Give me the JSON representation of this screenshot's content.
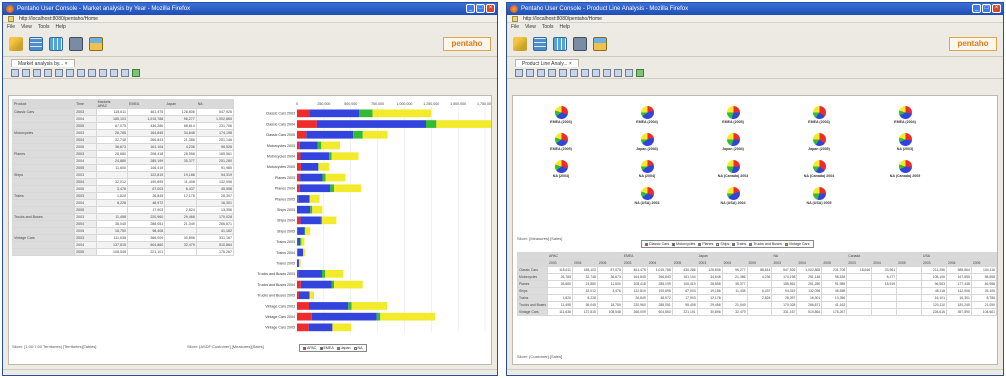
{
  "windows": {
    "left": {
      "title": "Pentaho User Console - Market analysis by Year - Mozilla Firefox",
      "url": "http://localhost:8080/pentaho/Home",
      "menu": [
        "File",
        "View",
        "Tools",
        "Help"
      ],
      "tab_label": "Market analysis by... ×",
      "footer_left": "Slicer: [1:00:7:00 Territories] [Territories][Tables]",
      "footer_right": "Slicer: [ASDF:Customer] [Measures][Sales]"
    },
    "right": {
      "title": "Pentaho User Console - Product Line Analysis - Mozilla Firefox",
      "url": "http://localhost:8080/pentaho/Home",
      "menu": [
        "File",
        "View",
        "Tools",
        "Help"
      ],
      "tab_label": "Product Line Analy... ×",
      "slicer_top": "Slicer: [Measures].[Sales]",
      "slicer_bottom": "Slicer: [Customer].[Sales]"
    }
  },
  "brand": {
    "logo_text": "pentaho",
    "accent": "#e07a20",
    "titlebar": "#1f4fb5"
  },
  "icons": [
    "edit-report-icon",
    "analysis-view-icon",
    "report-icon",
    "save-icon",
    "open-folder-icon"
  ],
  "pivot_left": {
    "headers": [
      "Product",
      "Time",
      "Markets",
      "APAC",
      "EMEA",
      "Japan",
      "NA"
    ],
    "rows": [
      [
        "Classic Cars",
        "2003",
        "115,611",
        "461,475",
        "126,806",
        "547,926"
      ],
      [
        "",
        "2004",
        "185,103",
        "1,015,788",
        "96,277",
        "1,002,865"
      ],
      [
        "",
        "2005",
        "87,075",
        "436,286",
        "88,814",
        "231,706"
      ],
      [
        "Motorcycles",
        "2003",
        "26,785",
        "164,845",
        "34,648",
        "174,198"
      ],
      [
        "",
        "2004",
        "32,748",
        "266,843",
        "21,386",
        "251,146"
      ],
      [
        "",
        "2005",
        "36,673",
        "161,104",
        "4,236",
        "98,528"
      ],
      [
        "Planes",
        "2003",
        "28,680",
        "208,418",
        "28,558",
        "185,561"
      ],
      [
        "",
        "2004",
        "24,880",
        "285,199",
        "35,377",
        "251,280"
      ],
      [
        "",
        "2005",
        "11,600",
        "106,419",
        "",
        "91,985"
      ],
      [
        "Ships",
        "2003",
        "",
        "122,819",
        "19,186",
        "94,319"
      ],
      [
        "",
        "2004",
        "32,012",
        "190,895",
        "11,408",
        "132,098"
      ],
      [
        "",
        "2005",
        "3,476",
        "67,003",
        "6,437",
        "45,558"
      ],
      [
        "Trains",
        "2003",
        "1,820",
        "26,849",
        "12,178",
        "28,397"
      ],
      [
        "",
        "2004",
        "8,228",
        "48,972",
        "",
        "16,301"
      ],
      [
        "",
        "2005",
        "",
        "17,903",
        "2,824",
        "13,356"
      ],
      [
        "Trucks and Buses",
        "2003",
        "11,498",
        "220,960",
        "29,468",
        "170,028"
      ],
      [
        "",
        "2004",
        "36,045",
        "288,051",
        "21,049",
        "266,671"
      ],
      [
        "",
        "2005",
        "18,750",
        "98,408",
        "",
        "41,162"
      ],
      [
        "Vintage Cars",
        "2003",
        "111,638",
        "366,009",
        "30,896",
        "331,167"
      ],
      [
        "",
        "2004",
        "137,815",
        "604,860",
        "32,479",
        "510,864"
      ],
      [
        "",
        "2005",
        "108,548",
        "221,101",
        "",
        "176,267"
      ]
    ]
  },
  "chart_data": [
    {
      "type": "bar",
      "orientation": "horizontal",
      "stacked": true,
      "categories": [
        "Classic Cars 2003",
        "Classic Cars 2004",
        "Classic Cars 2005",
        "Motorcycles 2003",
        "Motorcycles 2004",
        "Motorcycles 2005",
        "Planes 2003",
        "Planes 2004",
        "Planes 2005",
        "Ships 2003",
        "Ships 2004",
        "Ships 2005",
        "Trains 2003",
        "Trains 2004",
        "Trains 2005",
        "Trucks and Buses 2003",
        "Trucks and Buses 2004",
        "Trucks and Buses 2005",
        "Vintage Cars 2003",
        "Vintage Cars 2004",
        "Vintage Cars 2005"
      ],
      "series": [
        {
          "name": "APAC",
          "color": "#ee2c2c",
          "values": [
            115611,
            185103,
            87075,
            26785,
            32748,
            36673,
            28680,
            24880,
            11600,
            0,
            32012,
            3476,
            1820,
            8228,
            0,
            11498,
            36045,
            18750,
            111638,
            137815,
            108548
          ]
        },
        {
          "name": "EMEA",
          "color": "#3344dd",
          "values": [
            461475,
            1015788,
            436286,
            164845,
            266843,
            161104,
            208418,
            285199,
            106419,
            122819,
            190895,
            67003,
            26849,
            48972,
            17903,
            220960,
            288051,
            98408,
            366009,
            604860,
            221101
          ]
        },
        {
          "name": "Japan",
          "color": "#33bb33",
          "values": [
            126806,
            96277,
            88814,
            34648,
            21386,
            4236,
            28558,
            35377,
            0,
            19186,
            11408,
            6437,
            12178,
            0,
            2824,
            29468,
            21049,
            0,
            30896,
            32479,
            0
          ]
        },
        {
          "name": "NA",
          "color": "#f2ea2a",
          "values": [
            547926,
            1002865,
            231706,
            174198,
            251146,
            98528,
            185561,
            251280,
            91985,
            94319,
            132098,
            45558,
            28397,
            16301,
            13356,
            170028,
            266671,
            41162,
            331167,
            510864,
            176267
          ]
        }
      ],
      "xticks": [
        "0",
        "250,000",
        "500,000",
        "750,000",
        "1,000,000",
        "1,250,000",
        "1,500,000",
        "1,750,000"
      ],
      "xlim": [
        0,
        1750000
      ],
      "legend": [
        "APAC",
        "EMEA",
        "Japan",
        "NA"
      ],
      "legend_position": "bottom"
    },
    {
      "type": "pie",
      "small_multiples": true,
      "slice_colors": [
        "#ee2c2c",
        "#3344dd",
        "#33bb33",
        "#f2ea2a"
      ],
      "labels": [
        "EMEA (2003)",
        "EMEA (2004)",
        "EMEA (2005)",
        "EMEA (2003)",
        "EMEA (2004)",
        "EMEA (2005)",
        "Japan (2003)",
        "Japan (2004)",
        "Japan (2005)",
        "NA (2003)",
        "NA (2003)",
        "NA (2004)",
        "NA (Canada) 2003",
        "NA (Canada) 2004",
        "NA (Canada) 2005",
        "NA (USA) 2003",
        "NA (USA) 2004",
        "NA (USA) 2005"
      ],
      "legend": [
        "Classic Cars",
        "Motorcycles",
        "Planes",
        "Ships",
        "Trains",
        "Trucks and Buses",
        "Vintage Cars"
      ],
      "legend_position": "bottom"
    }
  ],
  "pivot_right": {
    "col_groups": [
      "APAC",
      "EMEA",
      "Japan",
      "NA",
      "Canada",
      "USA"
    ],
    "years": [
      "2003",
      "2004",
      "2005"
    ],
    "rows": [
      {
        "label": "Classic Cars",
        "values": [
          "115,611",
          "185,103",
          "87,075",
          "461,475",
          "1,015,788",
          "436,286",
          "126,806",
          "96,277",
          "88,814",
          "547,926",
          "1,002,865",
          "231,706",
          "18,646",
          "33,961",
          "",
          "211,256",
          "585,864",
          "104,116"
        ]
      },
      {
        "label": "Motorcycles",
        "values": [
          "26,785",
          "32,748",
          "36,673",
          "164,845",
          "266,843",
          "161,104",
          "34,648",
          "21,386",
          "4,236",
          "174,198",
          "251,146",
          "98,528",
          "",
          "8,177",
          "",
          "108,106",
          "167,855",
          "58,558"
        ]
      },
      {
        "label": "Planes",
        "values": [
          "28,680",
          "24,880",
          "11,600",
          "208,418",
          "285,199",
          "106,419",
          "28,558",
          "35,377",
          "",
          "185,561",
          "251,280",
          "91,985",
          "",
          "18,919",
          "",
          "96,553",
          "177,438",
          "46,986"
        ]
      },
      {
        "label": "Ships",
        "values": [
          "",
          "32,012",
          "3,476",
          "122,819",
          "190,895",
          "67,003",
          "19,186",
          "11,408",
          "6,437",
          "94,319",
          "132,098",
          "45,558",
          "",
          "",
          "",
          "48,118",
          "112,006",
          "25,106"
        ]
      },
      {
        "label": "Trains",
        "values": [
          "1,820",
          "8,228",
          "",
          "26,849",
          "48,972",
          "17,903",
          "12,178",
          "",
          "2,824",
          "28,397",
          "16,301",
          "13,356",
          "",
          "",
          "",
          "16,101",
          "16,301",
          "8,786"
        ]
      },
      {
        "label": "Trucks and Buses",
        "values": [
          "11,498",
          "36,045",
          "18,750",
          "220,960",
          "288,051",
          "98,408",
          "29,468",
          "21,049",
          "",
          "170,028",
          "266,671",
          "41,162",
          "",
          "",
          "",
          "120,110",
          "181,245",
          "21,050"
        ]
      },
      {
        "label": "Vintage Cars",
        "values": [
          "111,638",
          "137,815",
          "108,548",
          "366,009",
          "604,860",
          "221,101",
          "30,896",
          "32,479",
          "",
          "331,167",
          "510,864",
          "176,267",
          "",
          "",
          "",
          "228,616",
          "357,890",
          "104,661"
        ]
      }
    ]
  }
}
